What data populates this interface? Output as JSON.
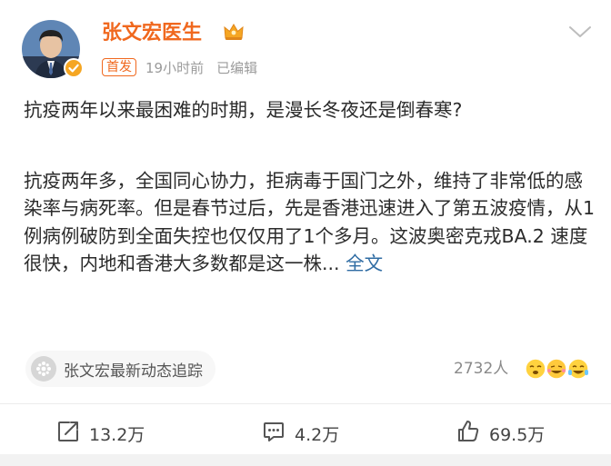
{
  "author": {
    "name": "张文宏医生",
    "tag": "首发",
    "time": "19小时前",
    "edited": "已编辑"
  },
  "post": {
    "headline": "抗疫两年以来最困难的时期，是漫长冬夜还是倒春寒?",
    "body": "抗疫两年多，全国同心协力，拒病毒于国门之外，维持了非常低的感染率与病死率。但是春节过后，先是香港迅速进入了第五波疫情，从1例病例破防到全面失控也仅仅用了1个多月。这波奥密克戎BA.2 速度很快，内地和香港大多数都是这一株...",
    "more_label": "全文"
  },
  "topic": {
    "label": "张文宏最新动态追踪"
  },
  "views": "2732人",
  "actions": {
    "repost": "13.2万",
    "comment": "4.2万",
    "like": "69.5万"
  },
  "colors": {
    "name": "#f0681e",
    "link": "#2f6ca3",
    "verified": "#f5a623"
  }
}
